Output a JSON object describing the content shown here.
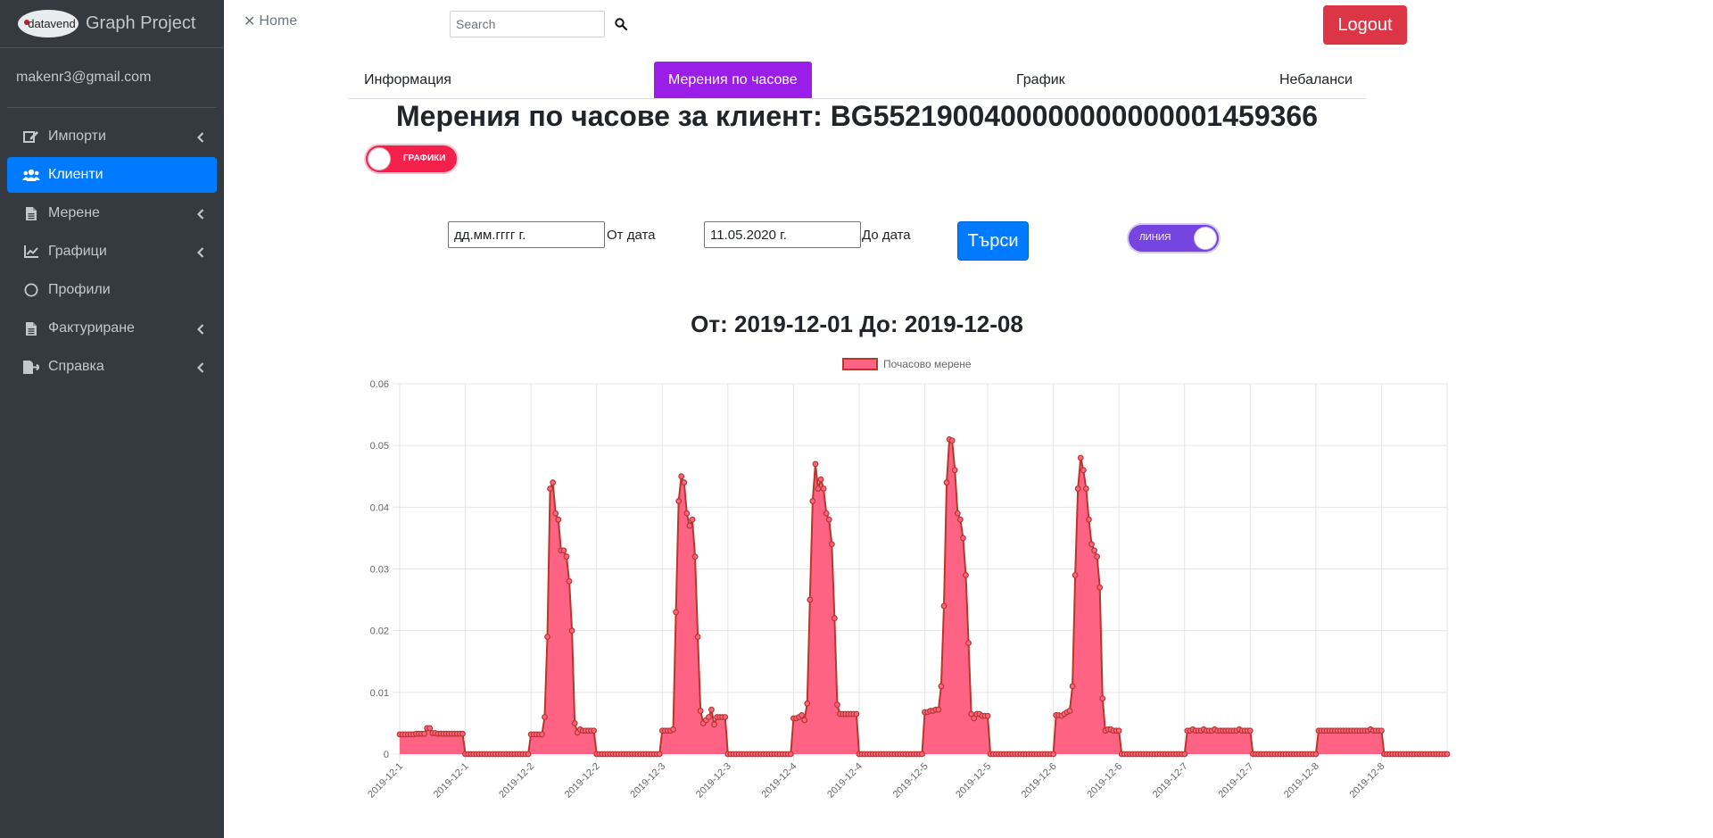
{
  "sidebar": {
    "logo_text": "datavend",
    "brand_title": "Graph Project",
    "user_email": "makenr3@gmail.com",
    "items": [
      {
        "label": "Импорти",
        "icon": "edit-icon",
        "has_caret": true,
        "active": false
      },
      {
        "label": "Клиенти",
        "icon": "users-icon",
        "has_caret": false,
        "active": true
      },
      {
        "label": "Мерене",
        "icon": "file-icon",
        "has_caret": true,
        "active": false
      },
      {
        "label": "Графици",
        "icon": "line-chart-icon",
        "has_caret": true,
        "active": false
      },
      {
        "label": "Профили",
        "icon": "circle-icon",
        "has_caret": false,
        "active": false
      },
      {
        "label": "Фактуриране",
        "icon": "file-icon",
        "has_caret": true,
        "active": false
      },
      {
        "label": "Справка",
        "icon": "export-icon",
        "has_caret": true,
        "active": false
      }
    ]
  },
  "topbar": {
    "home_label": "Home",
    "search_placeholder": "Search",
    "logout_label": "Logout"
  },
  "tabs": [
    {
      "label": "Информация",
      "active": false
    },
    {
      "label": "Мерения по часове",
      "active": true
    },
    {
      "label": "График",
      "active": false
    },
    {
      "label": "Небаланси",
      "active": false
    }
  ],
  "heading": "Мерения по часове за клиент: BG5521900400000000000001459366",
  "toggle_charts_label": "ГРАФИКИ",
  "filter": {
    "from_value": "дд.мм.гггг г.",
    "from_label": "От дата",
    "to_value": "11.05.2020 г.",
    "to_label": "До дата",
    "search_label": "Търси",
    "line_toggle_label": "ЛИНИЯ"
  },
  "colors": {
    "sidebar_bg": "#343a40",
    "active_item": "#007bff",
    "active_tab": "#9b1de8",
    "logout": "#dc3545",
    "series_fill": "#ff6384",
    "series_line": "#b8372d"
  },
  "chart_data": {
    "type": "area",
    "title": "От: 2019-12-01 До: 2019-12-08",
    "legend": "Почасово мерене",
    "legend_position": "top",
    "grid": true,
    "ylim": [
      0,
      0.06
    ],
    "y_ticks": [
      "0",
      "0.01",
      "0.02",
      "0.03",
      "0.04",
      "0.05",
      "0.06"
    ],
    "x_tick_labels": [
      "2019-12-1",
      "2019-12-1",
      "2019-12-2",
      "2019-12-2",
      "2019-12-3",
      "2019-12-3",
      "2019-12-4",
      "2019-12-4",
      "2019-12-5",
      "2019-12-5",
      "2019-12-6",
      "2019-12-6",
      "2019-12-7",
      "2019-12-7",
      "2019-12-8",
      "2019-12-8"
    ],
    "series": [
      {
        "name": "Почасово мерене",
        "values": [
          0.0032,
          0.0032,
          0.0032,
          0.0032,
          0.0032,
          0.0032,
          0.0033,
          0.0033,
          0.0033,
          0.0033,
          0.0042,
          0.0042,
          0.0034,
          0.0034,
          0.0033,
          0.0033,
          0.0033,
          0.0033,
          0.0033,
          0.0033,
          0.0033,
          0.0033,
          0.0033,
          0.0033,
          0,
          0,
          0,
          0,
          0,
          0,
          0,
          0,
          0,
          0,
          0,
          0,
          0,
          0,
          0,
          0,
          0,
          0,
          0,
          0,
          0,
          0,
          0,
          0,
          0.0032,
          0.0032,
          0.0032,
          0.0032,
          0.0032,
          0.006,
          0.019,
          0.043,
          0.044,
          0.039,
          0.038,
          0.033,
          0.033,
          0.032,
          0.028,
          0.02,
          0.005,
          0.0035,
          0.004,
          0.0038,
          0.0038,
          0.0038,
          0.0038,
          0.0038,
          0,
          0,
          0,
          0,
          0,
          0,
          0,
          0,
          0,
          0,
          0,
          0,
          0,
          0,
          0,
          0,
          0,
          0,
          0,
          0,
          0,
          0,
          0,
          0,
          0.0038,
          0.0038,
          0.0038,
          0.0038,
          0.004,
          0.023,
          0.041,
          0.045,
          0.044,
          0.039,
          0.037,
          0.038,
          0.032,
          0.019,
          0.007,
          0.005,
          0.0055,
          0.006,
          0.0072,
          0.0048,
          0.006,
          0.006,
          0.006,
          0.006,
          0,
          0,
          0,
          0,
          0,
          0,
          0,
          0,
          0,
          0,
          0,
          0,
          0,
          0,
          0,
          0,
          0,
          0,
          0,
          0,
          0,
          0,
          0,
          0,
          0.0058,
          0.0058,
          0.006,
          0.0063,
          0.0055,
          0.0082,
          0.025,
          0.041,
          0.047,
          0.043,
          0.0445,
          0.043,
          0.039,
          0.038,
          0.034,
          0.022,
          0.008,
          0.0065,
          0.0065,
          0.0065,
          0.0065,
          0.0065,
          0.0065,
          0.0065,
          0,
          0,
          0,
          0,
          0,
          0,
          0,
          0,
          0,
          0,
          0,
          0,
          0,
          0,
          0,
          0,
          0,
          0,
          0,
          0,
          0,
          0,
          0,
          0,
          0.0068,
          0.0068,
          0.007,
          0.007,
          0.0072,
          0.0072,
          0.011,
          0.024,
          0.044,
          0.051,
          0.0508,
          0.046,
          0.039,
          0.038,
          0.035,
          0.029,
          0.018,
          0.0065,
          0.0058,
          0.0065,
          0.0065,
          0.0062,
          0.0062,
          0.0062,
          0,
          0,
          0,
          0,
          0,
          0,
          0,
          0,
          0,
          0,
          0,
          0,
          0,
          0,
          0,
          0,
          0,
          0,
          0,
          0,
          0,
          0,
          0,
          0,
          0.0063,
          0.0063,
          0.0062,
          0.0065,
          0.0068,
          0.007,
          0.011,
          0.029,
          0.043,
          0.048,
          0.046,
          0.043,
          0.038,
          0.034,
          0.033,
          0.032,
          0.027,
          0.009,
          0.0038,
          0.004,
          0.004,
          0.0038,
          0.0038,
          0.0038,
          0,
          0,
          0,
          0,
          0,
          0,
          0,
          0,
          0,
          0,
          0,
          0,
          0,
          0,
          0,
          0,
          0,
          0,
          0,
          0,
          0,
          0,
          0,
          0,
          0.0038,
          0.0038,
          0.004,
          0.0038,
          0.0038,
          0.0038,
          0.004,
          0.0038,
          0.0038,
          0.0038,
          0.004,
          0.0038,
          0.0038,
          0.0038,
          0.0038,
          0.0038,
          0.0038,
          0.0038,
          0.0038,
          0.004,
          0.0038,
          0.0038,
          0.0038,
          0.0038,
          0,
          0,
          0,
          0,
          0,
          0,
          0,
          0,
          0,
          0,
          0,
          0,
          0,
          0,
          0,
          0,
          0,
          0,
          0,
          0,
          0,
          0,
          0,
          0,
          0.0038,
          0.0038,
          0.0038,
          0.0038,
          0.0038,
          0.0038,
          0.0038,
          0.0038,
          0.0038,
          0.0038,
          0.0038,
          0.0038,
          0.0038,
          0.0038,
          0.0038,
          0.0038,
          0.0038,
          0.0038,
          0.0038,
          0.004,
          0.0038,
          0.0038,
          0.0038,
          0.0038,
          0,
          0,
          0,
          0,
          0,
          0,
          0,
          0,
          0,
          0,
          0,
          0,
          0,
          0,
          0,
          0,
          0,
          0,
          0,
          0,
          0,
          0,
          0,
          0
        ]
      }
    ]
  }
}
